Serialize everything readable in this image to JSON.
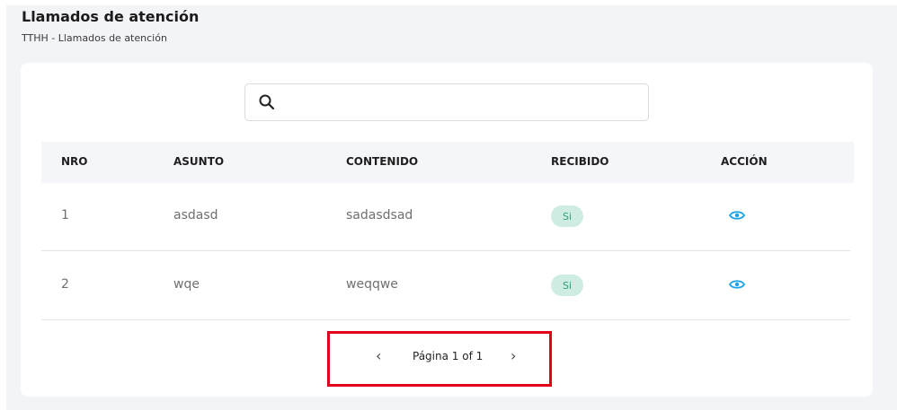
{
  "page": {
    "title": "Llamados de atención",
    "breadcrumb": "TTHH  - Llamados de atención"
  },
  "search": {
    "placeholder": "",
    "value": ""
  },
  "table": {
    "columns": [
      "NRO",
      "ASUNTO",
      "CONTENIDO",
      "RECIBIDO",
      "ACCIÓN"
    ],
    "rows": [
      {
        "nro": "1",
        "asunto": "asdasd",
        "contenido": "sadasdsad",
        "recibido": "Si"
      },
      {
        "nro": "2",
        "asunto": "wqe",
        "contenido": "weqqwe",
        "recibido": "Si"
      }
    ]
  },
  "pagination": {
    "prev_symbol": "‹",
    "label": "Página 1 of 1",
    "next_symbol": "›"
  },
  "colors": {
    "accent": "#1aa3e8",
    "badge_bg": "#cfece3",
    "badge_text": "#2e9e7b",
    "highlight_box": "#e0001a"
  }
}
